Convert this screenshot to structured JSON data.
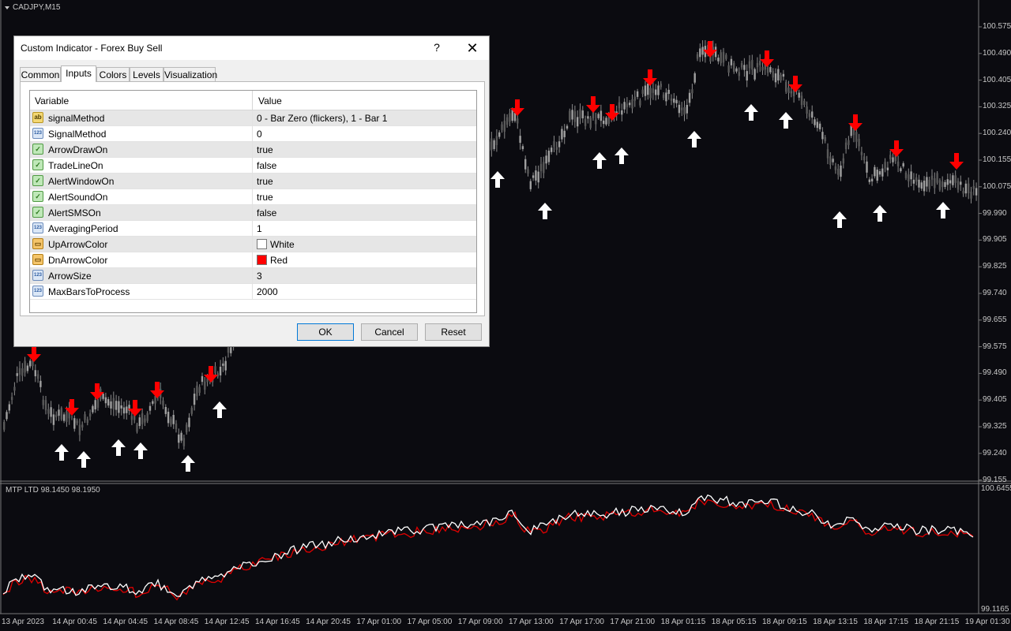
{
  "chart": {
    "title": "CADJPY,M15",
    "price_labels": [
      "100.575",
      "100.490",
      "100.405",
      "100.325",
      "100.240",
      "100.155",
      "100.075",
      "99.990",
      "99.905",
      "99.825",
      "99.740",
      "99.655",
      "99.575",
      "99.490",
      "99.405",
      "99.325",
      "99.240",
      "99.155"
    ],
    "indicator_title": "MTP LTD 98.1450 98.1950",
    "indicator_labels": [
      "100.6455",
      "99.1165"
    ],
    "time_labels": [
      "13 Apr 2023",
      "14 Apr 00:45",
      "14 Apr 04:45",
      "14 Apr 08:45",
      "14 Apr 12:45",
      "14 Apr 16:45",
      "14 Apr 20:45",
      "17 Apr 01:00",
      "17 Apr 05:00",
      "17 Apr 09:00",
      "17 Apr 13:00",
      "17 Apr 17:00",
      "17 Apr 21:00",
      "18 Apr 01:15",
      "18 Apr 05:15",
      "18 Apr 09:15",
      "18 Apr 13:15",
      "18 Apr 17:15",
      "18 Apr 21:15",
      "19 Apr 01:30"
    ],
    "colors": {
      "background": "#0b0b10",
      "up_arrow": "#ffffff",
      "down_arrow": "#ff0000",
      "candle": "#8a8a8a",
      "line_white": "#ffffff",
      "line_red": "#e00000"
    }
  },
  "dialog": {
    "title": "Custom Indicator - Forex Buy Sell",
    "help": "?",
    "close": "✕",
    "tabs": [
      "Common",
      "Inputs",
      "Colors",
      "Levels",
      "Visualization"
    ],
    "active_tab": "Inputs",
    "table": {
      "headers": [
        "Variable",
        "Value"
      ],
      "rows": [
        {
          "icon": "ab",
          "name": "signalMethod",
          "value": "0 - Bar Zero (flickers), 1 - Bar 1"
        },
        {
          "icon": "num",
          "name": "SignalMethod",
          "value": "0"
        },
        {
          "icon": "bool",
          "name": "ArrowDrawOn",
          "value": "true"
        },
        {
          "icon": "bool",
          "name": "TradeLineOn",
          "value": "false"
        },
        {
          "icon": "bool",
          "name": "AlertWindowOn",
          "value": "true"
        },
        {
          "icon": "bool",
          "name": "AlertSoundOn",
          "value": "true"
        },
        {
          "icon": "bool",
          "name": "AlertSMSOn",
          "value": "false"
        },
        {
          "icon": "num",
          "name": "AveragingPeriod",
          "value": "1"
        },
        {
          "icon": "color",
          "name": "UpArrowColor",
          "value": "White",
          "swatch": "#ffffff"
        },
        {
          "icon": "color",
          "name": "DnArrowColor",
          "value": "Red",
          "swatch": "#ff0000"
        },
        {
          "icon": "num",
          "name": "ArrowSize",
          "value": "3"
        },
        {
          "icon": "num",
          "name": "MaxBarsToProcess",
          "value": "2000"
        }
      ]
    },
    "buttons": {
      "ok": "OK",
      "cancel": "Cancel",
      "reset": "Reset"
    },
    "icon_glyphs": {
      "ab": "ab",
      "num": "123",
      "bool": "✓",
      "color": "▭"
    }
  }
}
